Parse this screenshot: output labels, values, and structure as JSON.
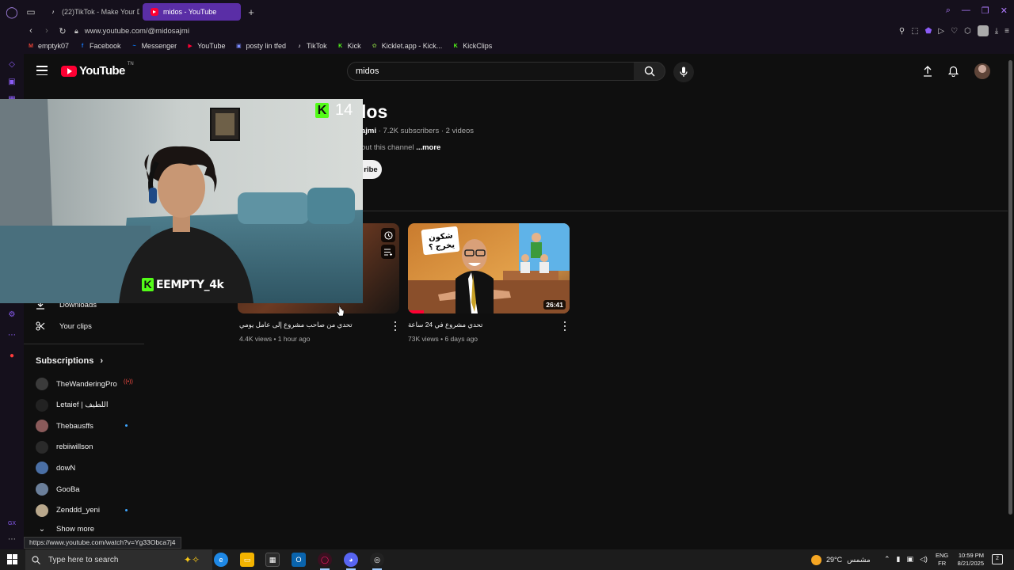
{
  "browser": {
    "tabs": [
      {
        "label": "(22)TikTok - Make Your D",
        "active": false
      },
      {
        "label": "midos - YouTube",
        "active": true
      }
    ],
    "url": "www.youtube.com/@midosajmi",
    "bookmarks": [
      {
        "label": "emptyk07",
        "icon": "gmail-icon",
        "color": "#ea4335"
      },
      {
        "label": "Facebook",
        "icon": "facebook-icon",
        "color": "#1877f2"
      },
      {
        "label": "Messenger",
        "icon": "messenger-icon",
        "color": "#0a7cff"
      },
      {
        "label": "YouTube",
        "icon": "youtube-icon",
        "color": "#ff0033"
      },
      {
        "label": "posty lin tfed",
        "icon": "image-icon",
        "color": "#7b8cff"
      },
      {
        "label": "TikTok",
        "icon": "tiktok-icon",
        "color": "#ffffff"
      },
      {
        "label": "Kick",
        "icon": "kick-icon",
        "color": "#53fc18"
      },
      {
        "label": "Kicklet.app - Kick...",
        "icon": "kicklet-icon",
        "color": "#6fa83a"
      },
      {
        "label": "KickClips",
        "icon": "kickclips-icon",
        "color": "#53fc18"
      }
    ],
    "status_url": "https://www.youtube.com/watch?v=Yg33Obca7j4"
  },
  "youtube": {
    "logo_word": "YouTube",
    "logo_suffix": "TN",
    "search_value": "midos",
    "channel": {
      "title_visible": "los",
      "handle_visible": "ajmi",
      "stats": " · 7.2K subscribers · 2 videos",
      "about_visible": "out this channel",
      "more_label": "...more",
      "subscribe_visible": "ribe"
    },
    "guide": {
      "downloads": "Downloads",
      "your_clips": "Your clips",
      "subscriptions_title": "Subscriptions",
      "subscriptions": [
        {
          "name": "TheWanderingPro",
          "avatar": "#3b3b3b",
          "marker": "live"
        },
        {
          "name": "Letaief | اللطيف",
          "avatar": "#222222",
          "marker": ""
        },
        {
          "name": "Thebausffs",
          "avatar": "#8a5a5a",
          "marker": "dot"
        },
        {
          "name": "rebiiwillson",
          "avatar": "#2a2a2a",
          "marker": ""
        },
        {
          "name": "dowN",
          "avatar": "#4a6fa5",
          "marker": ""
        },
        {
          "name": "GooBa",
          "avatar": "#6b7f9a",
          "marker": ""
        },
        {
          "name": "Zenddd_yeni",
          "avatar": "#b9a88c",
          "marker": "dot"
        }
      ],
      "show_more": "Show more"
    },
    "videos": [
      {
        "title": "تحدي من صاحب مشروع إلى عامل يومي",
        "meta": "4.4K views • 1 hour ago",
        "duration": ""
      },
      {
        "title": "تحدي مشروع في 24 ساعة",
        "meta": "73K views • 6 days ago",
        "duration": "26:41",
        "thumb_text": "شكون يخرج ؟"
      }
    ]
  },
  "overlay": {
    "viewer_count": "14",
    "streamer_name": "EEMPTY_4k"
  },
  "taskbar": {
    "search_placeholder": "Type here to search",
    "weather_temp": "29°C",
    "weather_label": "مشمس",
    "lang_top": "ENG",
    "lang_bottom": "FR",
    "time": "10:59 PM",
    "date": "8/21/2025"
  }
}
